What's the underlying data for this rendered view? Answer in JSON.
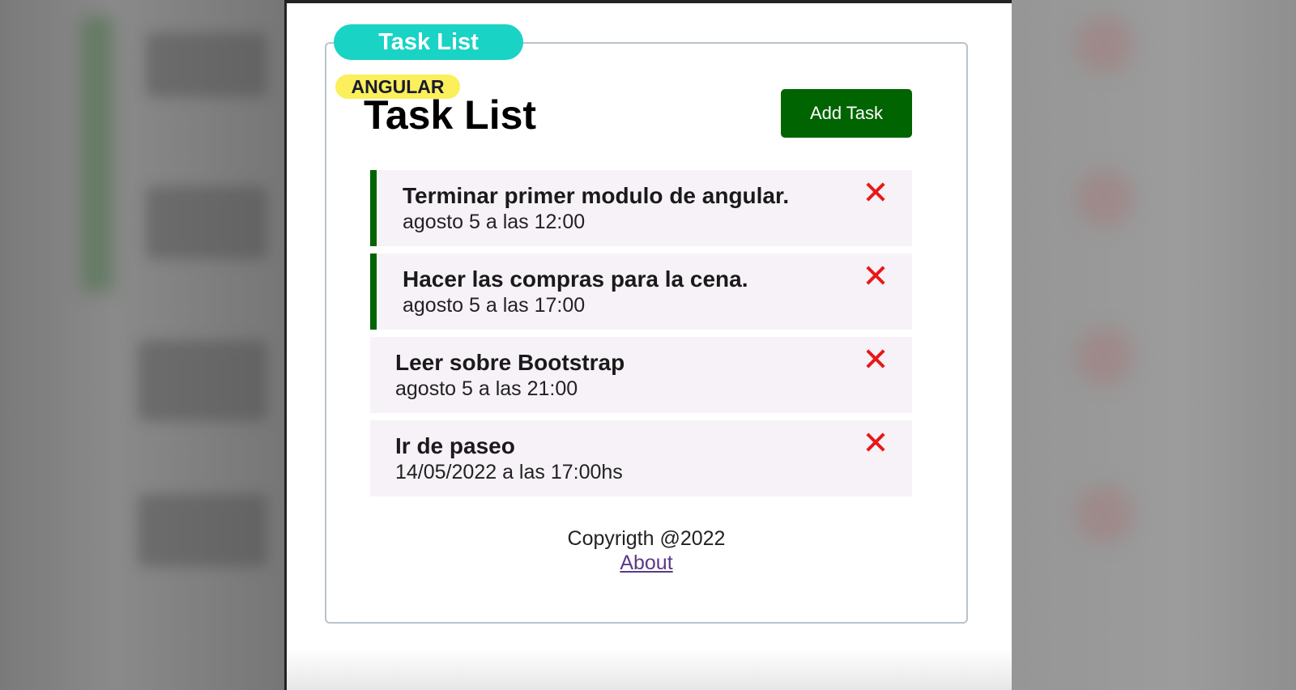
{
  "overlay": {
    "pill_label": "Task List",
    "badge_label": "ANGULAR"
  },
  "header": {
    "title": "Task List",
    "add_button_label": "Add Task"
  },
  "tasks": [
    {
      "text": "Terminar primer modulo de angular.",
      "day": "agosto 5 a las 12:00",
      "reminder": true
    },
    {
      "text": "Hacer las compras para la cena.",
      "day": "agosto 5 a las 17:00",
      "reminder": true
    },
    {
      "text": "Leer sobre Bootstrap",
      "day": "agosto 5 a las 21:00",
      "reminder": false
    },
    {
      "text": "Ir de paseo",
      "day": "14/05/2022 a las 17:00hs",
      "reminder": false
    }
  ],
  "footer": {
    "copyright": "Copyrigth @2022",
    "about_link": "About"
  },
  "colors": {
    "accent_green": "#006400",
    "delete_red": "#e81818",
    "pill_teal": "#19d3c5",
    "badge_yellow": "#fbef5b",
    "task_bg": "#f7f2f8"
  },
  "icons": {
    "delete": "close-icon"
  }
}
